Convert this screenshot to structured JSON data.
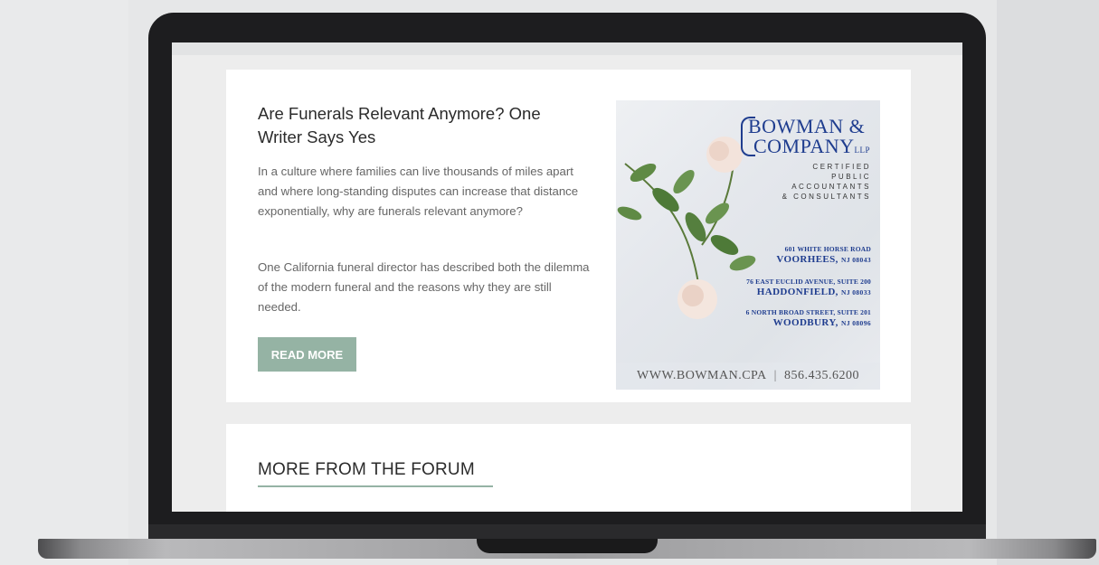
{
  "article": {
    "title": "Are Funerals Relevant Anymore? One Writer Says Yes",
    "paragraph1": "In a culture where families can live thousands of miles apart and where long-standing disputes can increase that distance exponentially, why are funerals relevant anymore?",
    "paragraph2": "One California funeral director has described both the dilemma of the modern funeral and the reasons why they are still needed.",
    "read_more_label": "READ MORE"
  },
  "ad": {
    "brand_line1": "BOWMAN &",
    "brand_line2": "COMPANY",
    "brand_suffix": "LLP",
    "services": [
      "CERTIFIED",
      "PUBLIC",
      "ACCOUNTANTS",
      "& CONSULTANTS"
    ],
    "addresses": [
      {
        "street": "601 WHITE HORSE ROAD",
        "city": "VOORHEES,",
        "zip": "NJ 08043"
      },
      {
        "street": "76 EAST EUCLID AVENUE, SUITE 200",
        "city": "HADDONFIELD,",
        "zip": "NJ 08033"
      },
      {
        "street": "6 NORTH BROAD STREET, SUITE 201",
        "city": "WOODBURY,",
        "zip": "NJ 08096"
      }
    ],
    "website": "WWW.BOWMAN.CPA",
    "separator": "|",
    "phone": "856.435.6200"
  },
  "forum": {
    "title": "MORE FROM THE FORUM"
  },
  "colors": {
    "accent": "#95b3a4",
    "brand_blue": "#1f3d8f",
    "laptop_bezel": "#1d1d1f"
  }
}
